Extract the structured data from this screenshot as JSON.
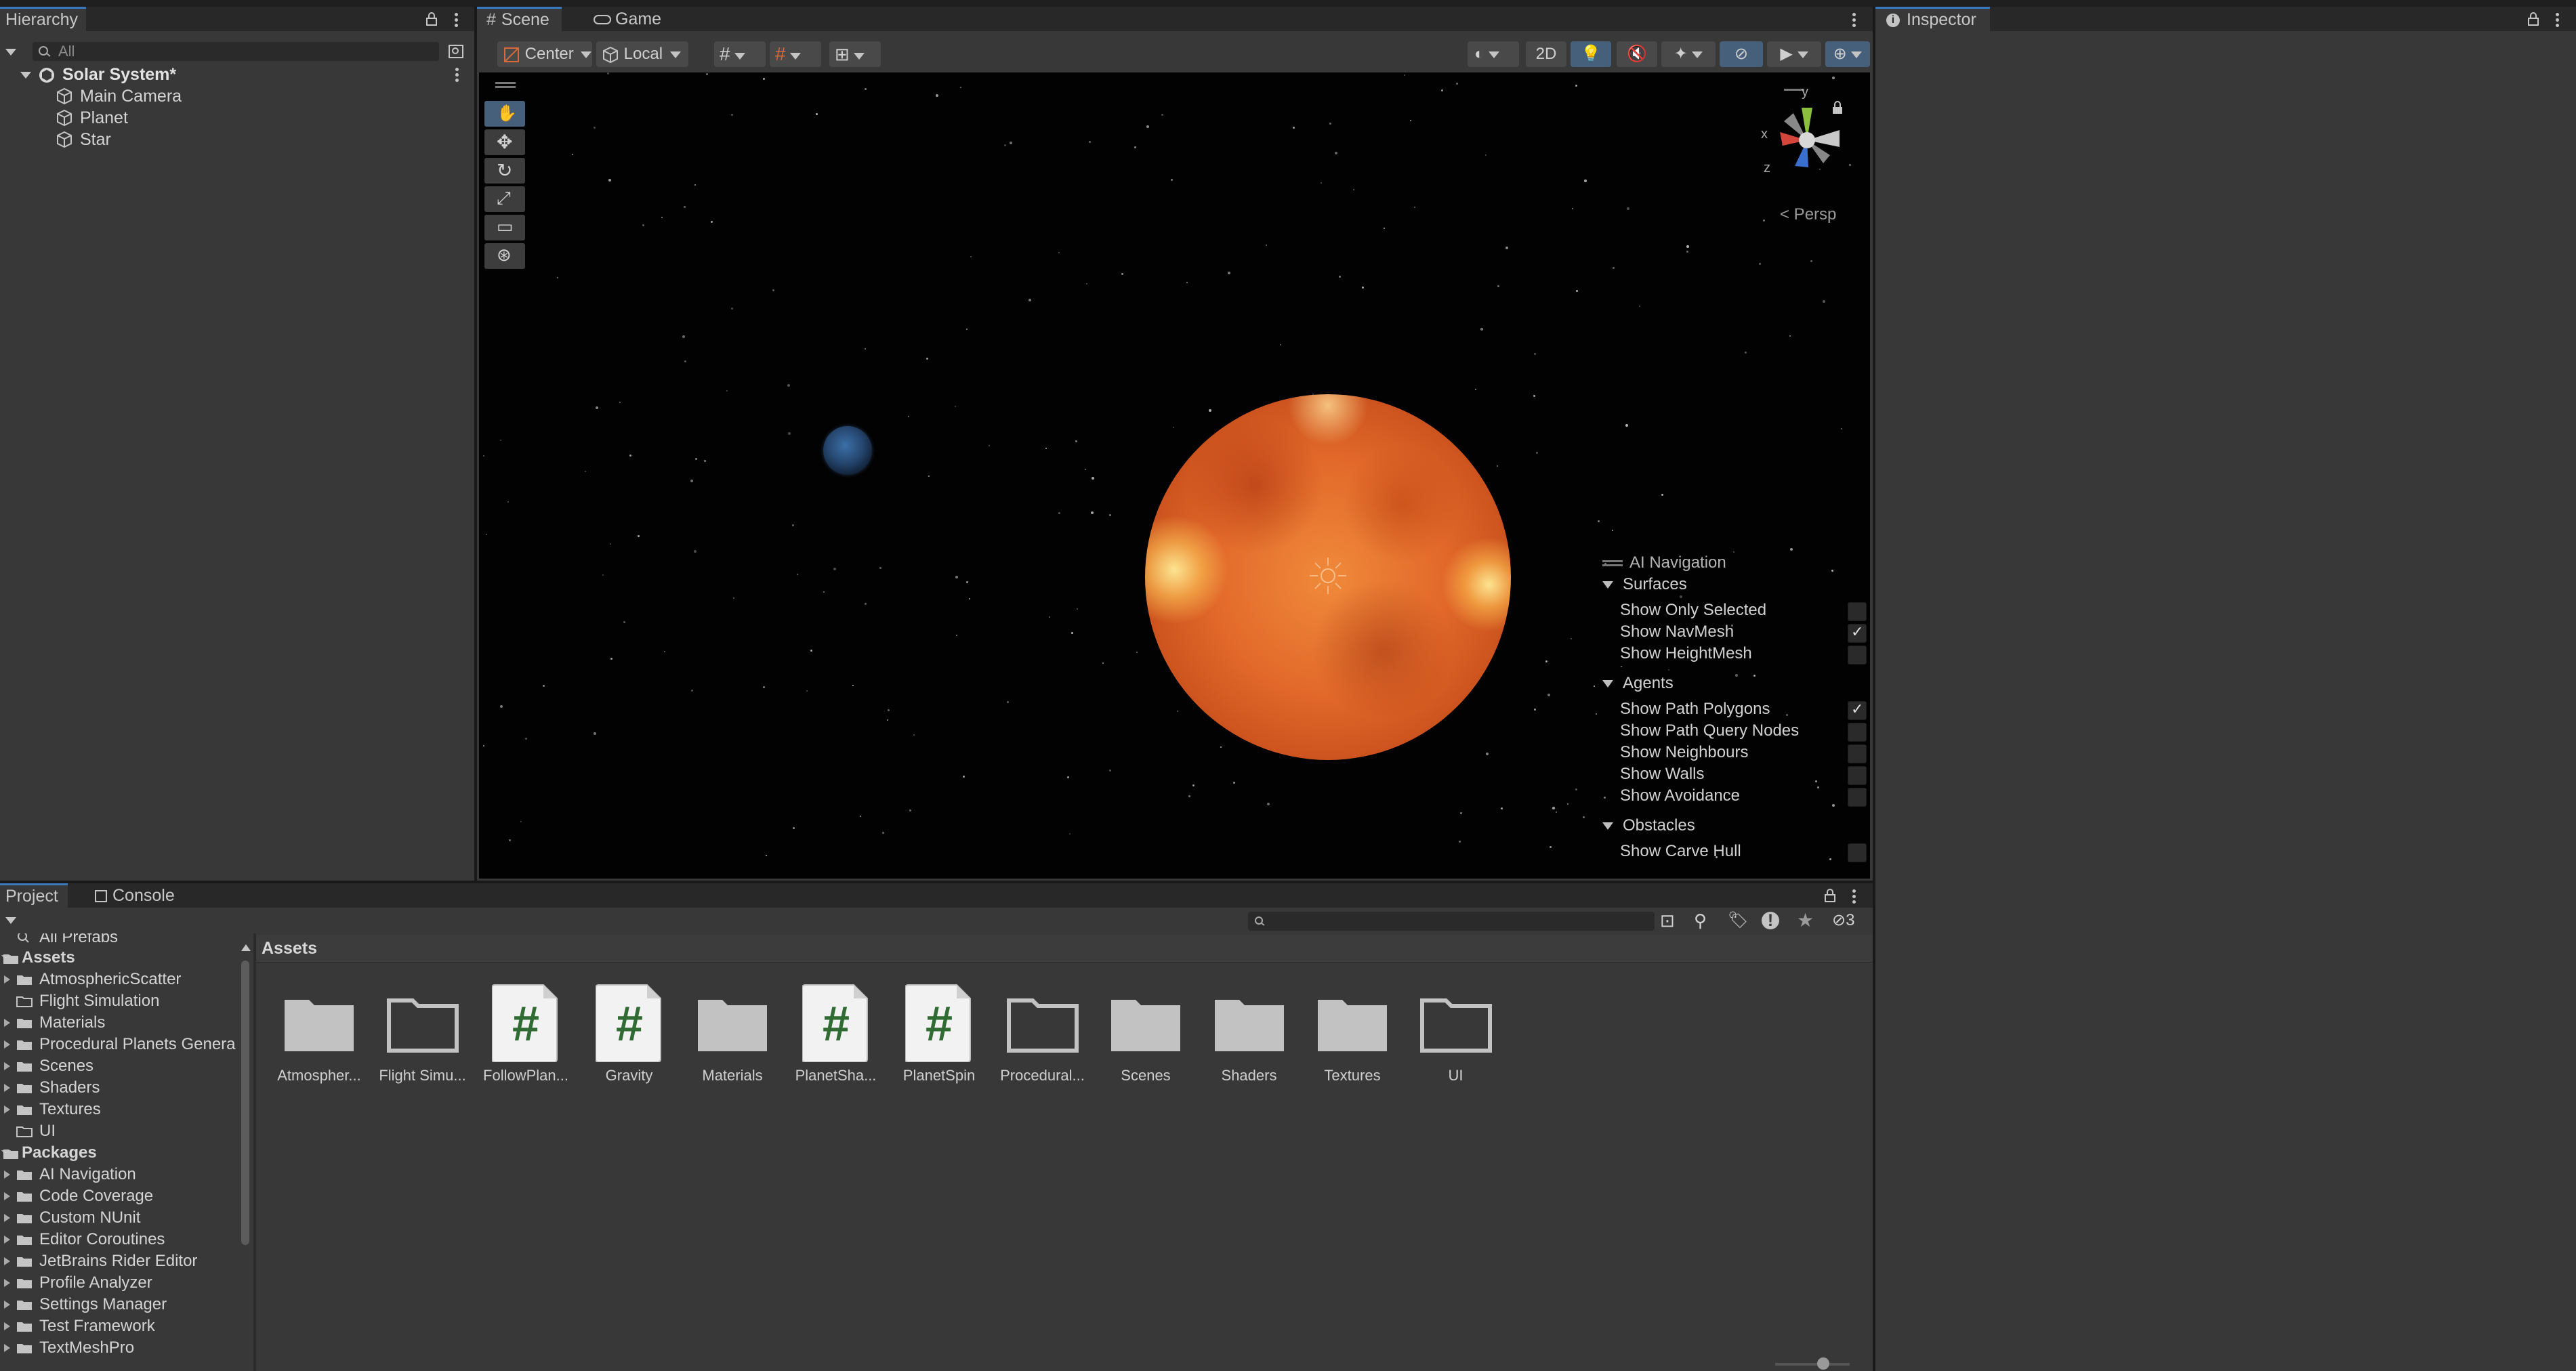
{
  "hierarchy": {
    "tab_label": "Hierarchy",
    "search_placeholder": "All",
    "scene_name": "Solar System*",
    "objects": [
      "Main Camera",
      "Planet",
      "Star"
    ]
  },
  "scene_tabs": [
    {
      "label": "Scene",
      "icon": "grid-icon"
    },
    {
      "label": "Game",
      "icon": "gamepad-icon"
    }
  ],
  "scene_toolbar": {
    "pivot": "Center",
    "space": "Local",
    "mode_2d": "2D",
    "persp_label": "< Persp",
    "gizmo_axes": {
      "x": "x",
      "y": "y",
      "z": "z"
    }
  },
  "inspector": {
    "tab_label": "Inspector"
  },
  "ai_navigation": {
    "title": "AI Navigation",
    "sections": [
      {
        "name": "Surfaces",
        "items": [
          {
            "label": "Show Only Selected",
            "checked": false
          },
          {
            "label": "Show NavMesh",
            "checked": true
          },
          {
            "label": "Show HeightMesh",
            "checked": false
          }
        ]
      },
      {
        "name": "Agents",
        "items": [
          {
            "label": "Show Path Polygons",
            "checked": true
          },
          {
            "label": "Show Path Query Nodes",
            "checked": false
          },
          {
            "label": "Show Neighbours",
            "checked": false
          },
          {
            "label": "Show Walls",
            "checked": false
          },
          {
            "label": "Show Avoidance",
            "checked": false
          }
        ]
      },
      {
        "name": "Obstacles",
        "items": [
          {
            "label": "Show Carve Hull",
            "checked": false
          }
        ]
      }
    ]
  },
  "bottom_tabs": [
    {
      "label": "Project",
      "icon": ""
    },
    {
      "label": "Console",
      "icon": "console-icon"
    }
  ],
  "project": {
    "hidden_count": "3",
    "breadcrumb": "Assets",
    "tree": {
      "favorite_partial": "All Prefabs",
      "assets_root": "Assets",
      "assets_children": [
        "AtmosphericScatter",
        "Flight Simulation",
        "Materials",
        "Procedural Planets Genera",
        "Scenes",
        "Shaders",
        "Textures",
        "UI"
      ],
      "packages_root": "Packages",
      "packages_children": [
        "AI Navigation",
        "Code Coverage",
        "Custom NUnit",
        "Editor Coroutines",
        "JetBrains Rider Editor",
        "Profile Analyzer",
        "Settings Manager",
        "Test Framework",
        "TextMeshPro"
      ]
    },
    "assets": [
      {
        "label": "Atmospher...",
        "kind": "folder-filled"
      },
      {
        "label": "Flight Simu...",
        "kind": "folder-empty"
      },
      {
        "label": "FollowPlan...",
        "kind": "script"
      },
      {
        "label": "Gravity",
        "kind": "script"
      },
      {
        "label": "Materials",
        "kind": "folder-filled"
      },
      {
        "label": "PlanetSha...",
        "kind": "script"
      },
      {
        "label": "PlanetSpin",
        "kind": "script"
      },
      {
        "label": "Procedural...",
        "kind": "folder-empty"
      },
      {
        "label": "Scenes",
        "kind": "folder-filled"
      },
      {
        "label": "Shaders",
        "kind": "folder-filled"
      },
      {
        "label": "Textures",
        "kind": "folder-filled"
      },
      {
        "label": "UI",
        "kind": "folder-empty"
      }
    ]
  },
  "colors": {
    "accent": "#3a79bb",
    "panel": "#383838",
    "script_hash": "#2f6b32",
    "sun": "#e2692a"
  }
}
